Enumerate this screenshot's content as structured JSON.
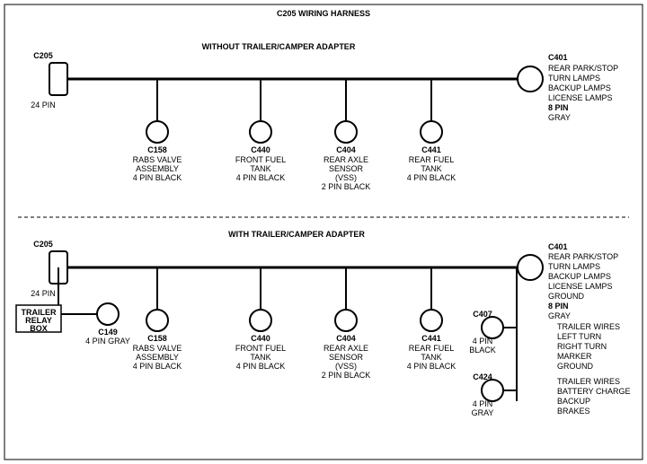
{
  "title": "C205 WIRING HARNESS",
  "top_section": {
    "label": "WITHOUT TRAILER/CAMPER ADAPTER",
    "left_connector": {
      "name": "C205",
      "pin_label": "24 PIN"
    },
    "right_connector": {
      "name": "C401",
      "pin_label": "8 PIN",
      "color": "GRAY",
      "description": "REAR PARK/STOP\nTURN LAMPS\nBACKUP LAMPS\nLICENSE LAMPS"
    },
    "connectors": [
      {
        "name": "C158",
        "desc": "RABS VALVE\nASSEMBLY\n4 PIN BLACK"
      },
      {
        "name": "C440",
        "desc": "FRONT FUEL\nTANK\n4 PIN BLACK"
      },
      {
        "name": "C404",
        "desc": "REAR AXLE\nSENSOR\n(VSS)\n2 PIN BLACK"
      },
      {
        "name": "C441",
        "desc": "REAR FUEL\nTANK\n4 PIN BLACK"
      }
    ]
  },
  "bottom_section": {
    "label": "WITH TRAILER/CAMPER ADAPTER",
    "left_connector": {
      "name": "C205",
      "pin_label": "24 PIN"
    },
    "right_connector": {
      "name": "C401",
      "pin_label": "8 PIN",
      "color": "GRAY",
      "description": "REAR PARK/STOP\nTURN LAMPS\nBACKUP LAMPS\nLICENSE LAMPS\nGROUND"
    },
    "extra_left": {
      "box_label": "TRAILER\nRELAY\nBOX",
      "connector_name": "C149",
      "connector_pins": "4 PIN GRAY"
    },
    "extra_right_1": {
      "connector_name": "C407",
      "pin_label": "4 PIN",
      "color": "BLACK",
      "description": "TRAILER WIRES\nLEFT TURN\nRIGHT TURN\nMARKER\nGROUND"
    },
    "extra_right_2": {
      "connector_name": "C424",
      "pin_label": "4 PIN",
      "color": "GRAY",
      "description": "TRAILER WIRES\nBATTERY CHARGE\nBACKUP\nBRAKES"
    },
    "connectors": [
      {
        "name": "C158",
        "desc": "RABS VALVE\nASSEMBLY\n4 PIN BLACK"
      },
      {
        "name": "C440",
        "desc": "FRONT FUEL\nTANK\n4 PIN BLACK"
      },
      {
        "name": "C404",
        "desc": "REAR AXLE\nSENSOR\n(VSS)\n2 PIN BLACK"
      },
      {
        "name": "C441",
        "desc": "REAR FUEL\nTANK\n4 PIN BLACK"
      }
    ]
  }
}
